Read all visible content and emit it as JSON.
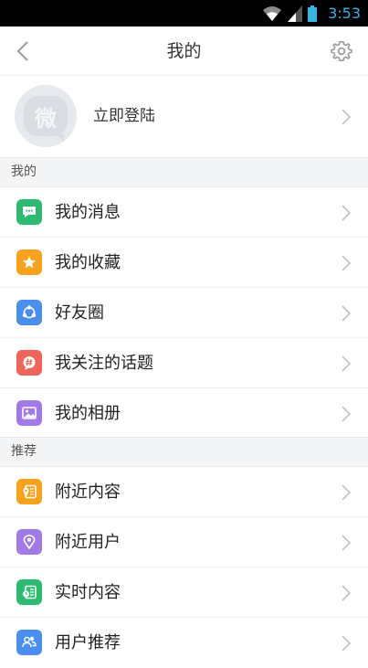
{
  "status": {
    "time": "3:53"
  },
  "nav": {
    "title": "我的"
  },
  "login": {
    "label": "立即登陆",
    "avatar_char": "微"
  },
  "sections": [
    {
      "header": "我的"
    },
    {
      "header": "推荐"
    }
  ],
  "items": [
    {
      "label": "我的消息",
      "icon": "chat-bubble-icon",
      "color": "#2dbb6f"
    },
    {
      "label": "我的收藏",
      "icon": "star-icon",
      "color": "#f8a21b"
    },
    {
      "label": "好友圈",
      "icon": "share-circle-icon",
      "color": "#4a8ff0"
    },
    {
      "label": "我关注的话题",
      "icon": "hashtag-bubble-icon",
      "color": "#f0645a"
    },
    {
      "label": "我的相册",
      "icon": "photo-icon",
      "color": "#a07be8"
    },
    {
      "label": "附近内容",
      "icon": "nearby-content-icon",
      "color": "#f8a21b"
    },
    {
      "label": "附近用户",
      "icon": "location-pin-icon",
      "color": "#a07be8"
    },
    {
      "label": "实时内容",
      "icon": "realtime-content-icon",
      "color": "#2dbb6f"
    },
    {
      "label": "用户推荐",
      "icon": "users-recommend-icon",
      "color": "#4a8ff0"
    }
  ]
}
